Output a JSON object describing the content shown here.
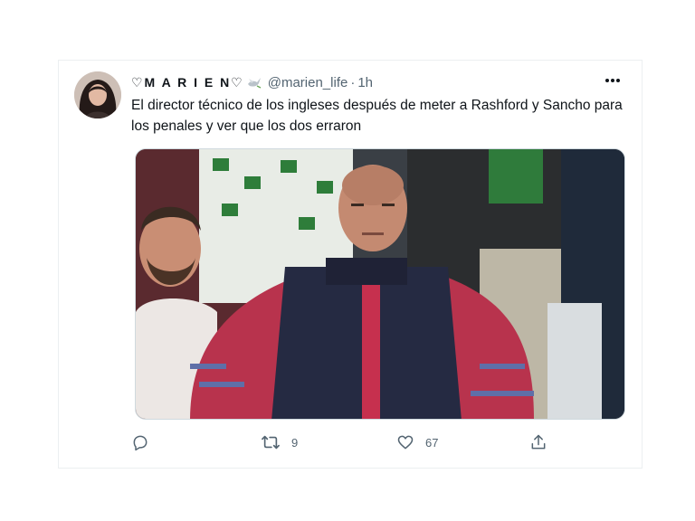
{
  "tweet": {
    "display_name": "♡M A R I E N♡",
    "handle": "@marien_life",
    "separator": "·",
    "time": "1h",
    "text": "El director técnico de los ingleses después de meter a Rashford y Sancho para los penales y ver que los dos erraron",
    "retweets": "9",
    "likes": "67"
  },
  "icons": {
    "more": "more-horizontal-icon",
    "reply": "reply-icon",
    "retweet": "retweet-icon",
    "like": "heart-icon",
    "share": "share-icon",
    "name_emoji": "dove-icon"
  },
  "colors": {
    "text": "#0f1419",
    "muted": "#536471",
    "border": "#cfd9de"
  }
}
